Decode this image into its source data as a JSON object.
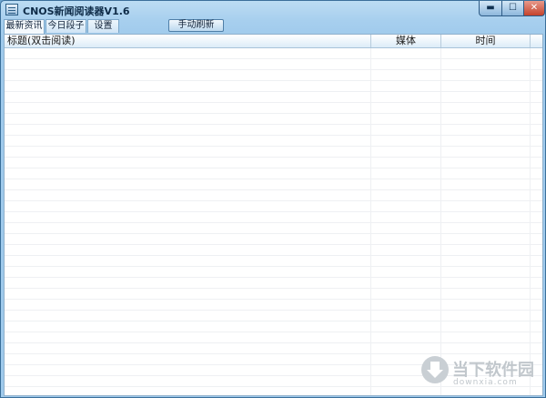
{
  "window": {
    "title": "CNOS新闻阅读器V1.6",
    "controls": {
      "minimize": "▬",
      "maximize": "☐",
      "close": "✕"
    }
  },
  "tabs": [
    {
      "label": "最新资讯",
      "active": true
    },
    {
      "label": "今日段子",
      "active": false
    },
    {
      "label": "设置",
      "active": false
    }
  ],
  "toolbar": {
    "refresh_label": "手动刷新"
  },
  "table": {
    "columns": [
      "标题(双击阅读)",
      "媒体",
      "时间"
    ],
    "rows": []
  },
  "watermark": {
    "text": "当下软件园",
    "subtext": "downxia.com"
  },
  "colors": {
    "titlebar": "#bcdcf3",
    "close_button": "#c4422b",
    "header": "#dcecf8"
  }
}
